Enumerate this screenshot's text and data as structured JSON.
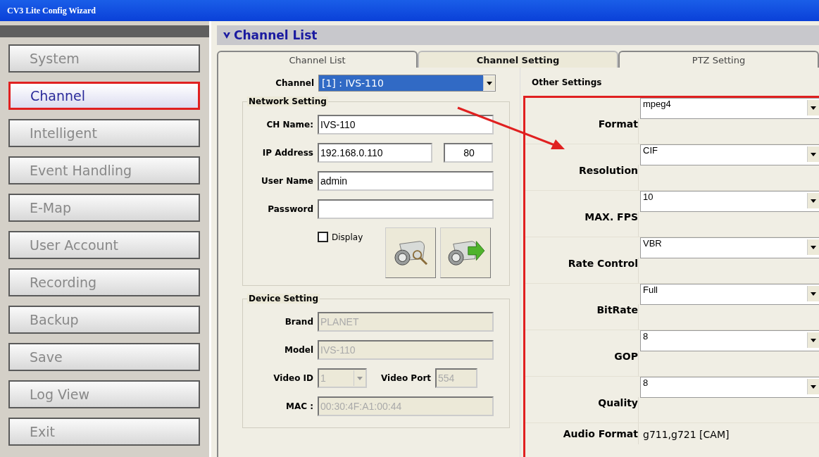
{
  "window": {
    "title": "CV3 Lite Config Wizard"
  },
  "sidebar": {
    "items": [
      {
        "label": "System",
        "selected": false
      },
      {
        "label": "Channel",
        "selected": true
      },
      {
        "label": "Intelligent",
        "selected": false
      },
      {
        "label": "Event Handling",
        "selected": false
      },
      {
        "label": "E-Map",
        "selected": false
      },
      {
        "label": "User Account",
        "selected": false
      },
      {
        "label": "Recording",
        "selected": false
      },
      {
        "label": "Backup",
        "selected": false
      },
      {
        "label": "Save",
        "selected": false
      },
      {
        "label": "Log View",
        "selected": false
      },
      {
        "label": "Exit",
        "selected": false
      }
    ]
  },
  "panel": {
    "title": "Channel List"
  },
  "tabs": [
    {
      "label": "Channel List",
      "selected": false
    },
    {
      "label": "Channel Setting",
      "selected": true
    },
    {
      "label": "PTZ Setting",
      "selected": false
    }
  ],
  "channel": {
    "label": "Channel",
    "value": "[1] : IVS-110"
  },
  "network_setting": {
    "title": "Network Setting",
    "fields": [
      {
        "label": "CH Name:",
        "value": "IVS-110"
      },
      {
        "label": "IP Address",
        "value": "192.168.0.110",
        "port": "80"
      },
      {
        "label": "User Name",
        "value": "admin"
      },
      {
        "label": "Password"
      }
    ],
    "display": {
      "label": "Display",
      "checked": false
    }
  },
  "device_setting": {
    "title": "Device Setting",
    "disabled": true,
    "fields": [
      {
        "label": "Brand",
        "value": "PLANET"
      },
      {
        "label": "Model",
        "value": "IVS-110"
      }
    ],
    "video_id": {
      "label": "Video ID",
      "value": "1"
    },
    "video_port": {
      "label": "Video Port",
      "value": "554"
    },
    "mac": {
      "label": "MAC :",
      "value": "00:30:4F:A1:00:44"
    }
  },
  "other_settings": {
    "title": "Other Settings",
    "rows": [
      {
        "label": "Format",
        "value": "mpeg4",
        "kind": "select"
      },
      {
        "label": "Resolution",
        "value": "CIF",
        "kind": "select"
      },
      {
        "label": "MAX. FPS",
        "value": "10",
        "kind": "select"
      },
      {
        "label": "Rate Control",
        "value": "VBR",
        "kind": "select"
      },
      {
        "label": "BitRate",
        "value": "Full",
        "kind": "select"
      },
      {
        "label": "GOP",
        "value": "8",
        "kind": "select"
      },
      {
        "label": "Quality",
        "value": "8",
        "kind": "select"
      },
      {
        "label": "Audio Format",
        "value": "g711,g721 [CAM]",
        "kind": "text"
      }
    ]
  }
}
